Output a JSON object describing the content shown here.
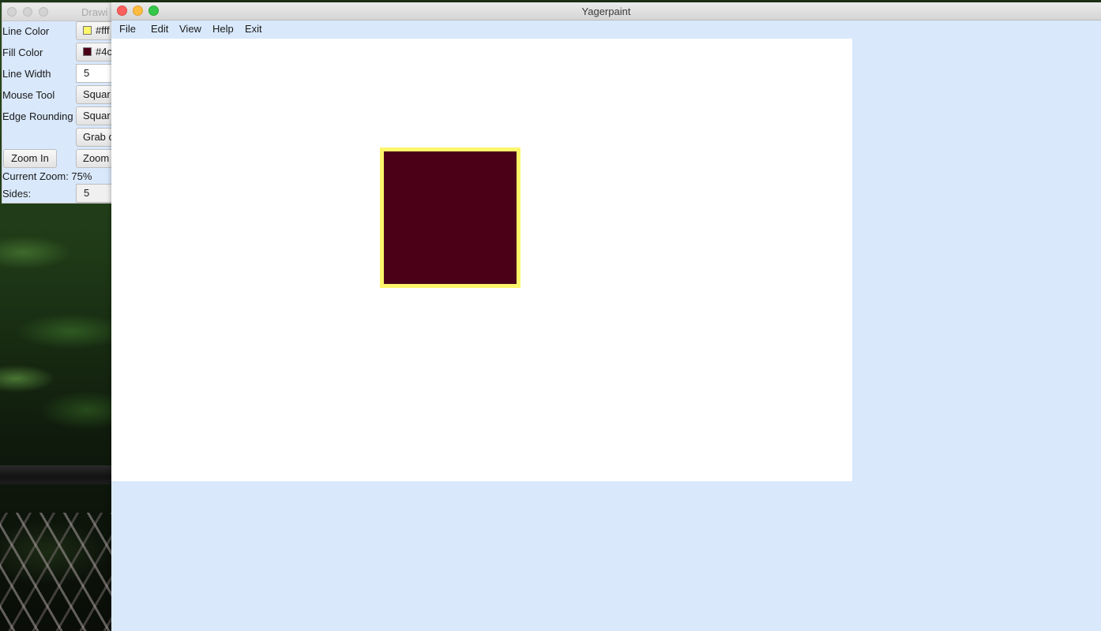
{
  "palette_window": {
    "title": "Drawi",
    "rows": {
      "line_color": {
        "label": "Line Color",
        "value": "#fff",
        "swatch": "#fef76b"
      },
      "fill_color": {
        "label": "Fill Color",
        "value": "#4c",
        "swatch": "#4b0018"
      },
      "line_width": {
        "label": "Line Width",
        "value": "5"
      },
      "mouse_tool": {
        "label": "Mouse Tool",
        "value": "Squar"
      },
      "edge_rounding": {
        "label": "Edge Rounding",
        "value": "Squar"
      },
      "grab": {
        "value": "Grab c"
      },
      "zoom_in": {
        "label": "Zoom In"
      },
      "zoom_out": {
        "value": "Zoom"
      },
      "current_zoom": {
        "label": "Current Zoom: 75%"
      },
      "sides": {
        "label": "Sides:",
        "value": "5"
      }
    }
  },
  "main_window": {
    "title": "Yagerpaint",
    "menu": [
      "File",
      "Edit",
      "View",
      "Help",
      "Exit"
    ]
  },
  "canvas": {
    "background": "#ffffff",
    "shape": {
      "type": "square",
      "fill": "#4b0018",
      "stroke": "#fdf66a"
    }
  },
  "colors": {
    "window_bg": "#d9e9fb",
    "canvas_bg": "#ffffff"
  }
}
